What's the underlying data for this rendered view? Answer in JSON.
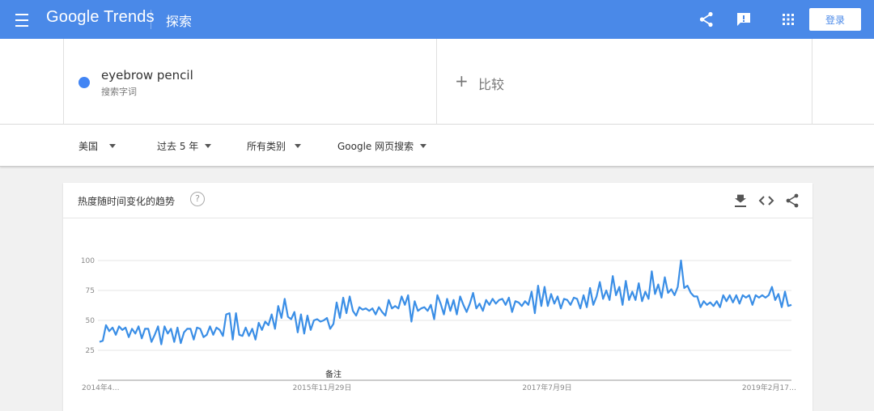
{
  "header": {
    "logo_google": "Google",
    "logo_trends": "Trends",
    "title": "探索",
    "login_label": "登录",
    "icons": [
      "menu-icon",
      "share-icon",
      "feedback-icon",
      "apps-icon"
    ]
  },
  "terms": {
    "items": [
      {
        "name": "eyebrow pencil",
        "subtitle": "搜索字词",
        "color": "#4285f4"
      }
    ],
    "compare_plus": "+",
    "compare_label": "比较"
  },
  "filters": {
    "region": "美国",
    "period": "过去 5 年",
    "category": "所有类别",
    "search_type": "Google 网页搜索"
  },
  "card": {
    "title": "热度随时间变化的趋势",
    "help": "?",
    "icons": [
      "download-icon",
      "embed-icon",
      "share-icon"
    ]
  },
  "chart_data": {
    "type": "line",
    "color": "#3a8ee6",
    "ylim": [
      0,
      100
    ],
    "y_ticks": [
      "100",
      "75",
      "50",
      "25"
    ],
    "x_tick_labels": [
      "2014年4…",
      "2015年11月29日",
      "2017年7月9日",
      "2019年2月17…"
    ],
    "annotation": "备注",
    "grid": true,
    "values": [
      32,
      33,
      46,
      41,
      44,
      38,
      45,
      42,
      44,
      36,
      43,
      39,
      45,
      35,
      43,
      43,
      32,
      38,
      45,
      30,
      45,
      39,
      43,
      32,
      44,
      31,
      40,
      43,
      43,
      34,
      44,
      43,
      36,
      38,
      45,
      38,
      44,
      42,
      37,
      55,
      56,
      34,
      56,
      38,
      37,
      44,
      37,
      43,
      34,
      48,
      42,
      49,
      46,
      55,
      43,
      62,
      52,
      68,
      53,
      51,
      57,
      40,
      55,
      39,
      54,
      42,
      50,
      51,
      49,
      50,
      52,
      43,
      47,
      65,
      52,
      69,
      56,
      70,
      58,
      54,
      61,
      59,
      60,
      58,
      60,
      55,
      61,
      57,
      54,
      67,
      60,
      62,
      60,
      70,
      63,
      71,
      49,
      66,
      58,
      60,
      61,
      58,
      63,
      51,
      71,
      64,
      55,
      68,
      58,
      67,
      55,
      70,
      63,
      57,
      64,
      73,
      60,
      64,
      58,
      67,
      63,
      68,
      64,
      67,
      68,
      63,
      69,
      57,
      66,
      65,
      62,
      66,
      63,
      74,
      56,
      79,
      62,
      78,
      62,
      72,
      64,
      70,
      60,
      68,
      67,
      63,
      69,
      68,
      60,
      71,
      61,
      77,
      63,
      70,
      82,
      68,
      75,
      67,
      87,
      71,
      78,
      63,
      83,
      67,
      74,
      67,
      81,
      66,
      74,
      68,
      91,
      72,
      80,
      69,
      86,
      73,
      76,
      71,
      78,
      100,
      77,
      79,
      73,
      70,
      70,
      61,
      66,
      63,
      65,
      62,
      66,
      61,
      71,
      66,
      71,
      65,
      71,
      64,
      71,
      69,
      71,
      63,
      71,
      69,
      71,
      69,
      71,
      78,
      67,
      72,
      61,
      74,
      62,
      63
    ]
  }
}
